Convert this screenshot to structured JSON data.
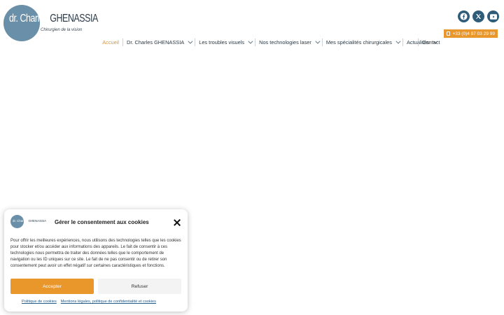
{
  "logo": {
    "first_name": "dr. Charles",
    "last_name": "GHENASSIA",
    "tagline": "Chirurgien de la vision"
  },
  "social": [
    {
      "icon": "facebook-icon"
    },
    {
      "icon": "x-icon"
    },
    {
      "icon": "youtube-icon"
    }
  ],
  "phone": {
    "label": "+33 (0)4 97 03 29 99",
    "icon": "phone-icon"
  },
  "nav": {
    "items": [
      {
        "label": "Accueil",
        "active": true,
        "dropdown": false
      },
      {
        "label": "Dr. Charles GHENASSIA",
        "active": false,
        "dropdown": true
      },
      {
        "label": "Les troubles visuels",
        "active": false,
        "dropdown": true
      },
      {
        "label": "Nos technologies laser",
        "active": false,
        "dropdown": true
      },
      {
        "label": "Mes spécialités chirurgicales",
        "active": false,
        "dropdown": true
      },
      {
        "label": "Actualités",
        "active": false,
        "dropdown": true
      }
    ],
    "contact": "Contact",
    "accent_color": "#e0952b"
  },
  "cookie": {
    "logo_first": "dr. Charles",
    "logo_last": "GHENASSIA",
    "title": "Gérer le consentement aux cookies",
    "body": "Pour offrir les meilleures expériences, nous utilisons des technologies telles que les cookies pour stocker et/ou accéder aux informations des appareils. Le fait de consentir à ces technologies nous permettra de traiter des données telles que le comportement de navigation ou les ID uniques sur ce site. Le fait de ne pas consentir ou de retirer son consentement peut avoir un effet négatif sur certaines caractéristiques et fonctions.",
    "accept": "Accepter",
    "refuse": "Refuser",
    "links": [
      "Politique de cookies",
      "Mentions légales, politique de confidentialité et cookies"
    ],
    "accept_color": "#e9962a"
  }
}
